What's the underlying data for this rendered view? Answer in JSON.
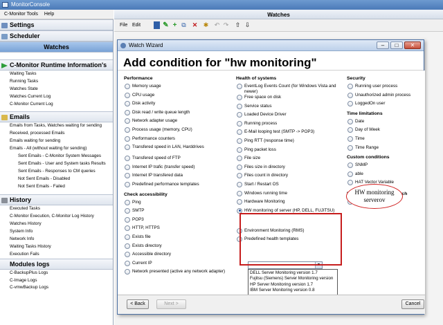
{
  "app": {
    "title": "MonitorConsole"
  },
  "menu": [
    "C-Monitor Tools",
    "Help"
  ],
  "nav": {
    "settings": "Settings",
    "scheduler": "Scheduler",
    "watches": "Watches",
    "runtime": {
      "title": "C-Monitor Runtime Information's",
      "items": [
        "Waiting Tasks",
        "Running Tasks",
        "Watches State",
        "Watches Current Log",
        "C-Monitor Current Log"
      ]
    },
    "emails": {
      "title": "Emails",
      "items": [
        "Emails from Tasks, Watches waiting for sending",
        "Received, processed Emails",
        "Emails waiting for sending",
        "Emails - All (without waiting for sending)"
      ],
      "sub_items": [
        "Sent Emails - C-Monitor System Messages",
        "Sent Emails - User and System tasks Results",
        "Sent Emails - Responses to CM queries",
        "Not Sent Emails - Disabled",
        "Not Sent Emails - Failed"
      ]
    },
    "history": {
      "title": "History",
      "items": [
        "Executed Tasks",
        "C-Monitor Execution, C-Monitor Log History",
        "Watches History",
        "System Info",
        "Network Info",
        "Waiting Tasks History",
        "Execution Fails"
      ]
    },
    "modules": {
      "title": "Modules logs",
      "items": [
        "C-BackupPlus Logs",
        "C-Image Logs",
        "C-vmwBackup Logs"
      ]
    }
  },
  "watches_header": "Watches",
  "toolbar": {
    "file": "File",
    "edit": "Edit"
  },
  "wizard": {
    "window_title": "Watch Wizard",
    "heading": "Add condition for \"hw monitoring\"",
    "col1": {
      "perf_header": "Performance",
      "perf": [
        "Memory usage",
        "CPU usage",
        "Disk activity",
        "Disk read / write queue length",
        "Network adapter usage",
        "Process usage (memory, CPU)",
        "Performance counters",
        "Transfered speed in LAN, Harddrives",
        "Transfered speed of FTP",
        "Internet IP trafic (transfer speed)",
        "Internet IP transfered data",
        "Predefined performance templates"
      ],
      "access_header": "Check accessibility",
      "access": [
        "Ping",
        "SMTP",
        "POP3",
        "HTTP, HTTPS",
        "Exists file",
        "Exists directory",
        "Accessible directory",
        "Current IP",
        "Network presented (active any network adapter)"
      ]
    },
    "col2": {
      "health_header": "Health of systems",
      "health": [
        "EventLog Events Count (for Windows Vista and newer)",
        "Free space on disk",
        "Service status",
        "Loaded Device Driver",
        "Running process",
        "E-Mail looping test (SMTP -> POP3)",
        "Ping RTT (response time)",
        "Ping packet loss",
        "File size",
        "Files size in directory",
        "Files count in directory",
        "Start / Restart OS",
        "Windows running time",
        "Hardware Monitoring",
        "HW monitoring of server (HP, DELL, FUJITSU)"
      ],
      "after": [
        "Environment Monitoring (RMS)",
        "Predefined health templates"
      ],
      "server_options": [
        "DELL Server Monitoring version 1.7",
        "Fujitsu (Siemens) Server Monitoring version",
        "HP Server Monitoring version 1.7",
        "IBM Server Monitoring version 0.8"
      ]
    },
    "col3": {
      "security_header": "Security",
      "security": [
        "Running user process",
        "Unauthorized admin process",
        "LoggedOn user"
      ],
      "time_header": "Time limitations",
      "time": [
        "Date",
        "Day of Week",
        "Time",
        "Time Range"
      ],
      "custom_header": "Custom conditions",
      "custom": [
        "SNMP",
        "able",
        "HAT Vector Variable"
      ],
      "watch_header": "Use state of another Watch",
      "watch": [
        "Watch state"
      ]
    },
    "callout": "HW monitoring serverov",
    "back": "< Back",
    "next": "Next >",
    "cancel": "Cancel"
  }
}
